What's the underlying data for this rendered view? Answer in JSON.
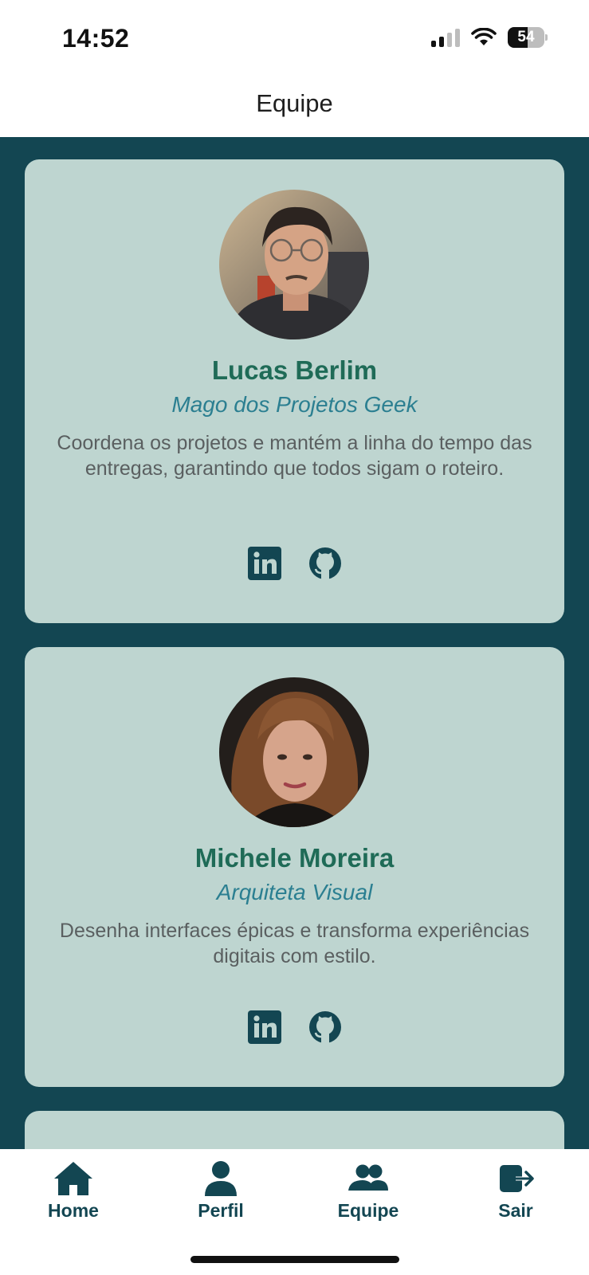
{
  "status_bar": {
    "time": "14:52",
    "battery": "54",
    "battery_level": 0.54
  },
  "header": {
    "title": "Equipe"
  },
  "members": [
    {
      "name": "Lucas Berlim",
      "role": "Mago dos Projetos Geek",
      "description": "Coordena os projetos e mantém a linha do tempo das entregas, garantindo que todos sigam o roteiro.",
      "socials": [
        "linkedin-icon",
        "github-icon"
      ]
    },
    {
      "name": "Michele Moreira",
      "role": "Arquiteta Visual",
      "description": "Desenha interfaces épicas e transforma experiências digitais com estilo.",
      "socials": [
        "linkedin-icon",
        "github-icon"
      ]
    }
  ],
  "tabs": [
    {
      "label": "Home",
      "icon": "home-icon"
    },
    {
      "label": "Perfil",
      "icon": "person-icon"
    },
    {
      "label": "Equipe",
      "icon": "group-icon"
    },
    {
      "label": "Sair",
      "icon": "logout-icon"
    }
  ],
  "colors": {
    "background": "#134652",
    "card": "#bed5d0",
    "name": "#1f6b57",
    "role": "#2b7f91",
    "description": "#5a5f60",
    "icon": "#134652"
  }
}
